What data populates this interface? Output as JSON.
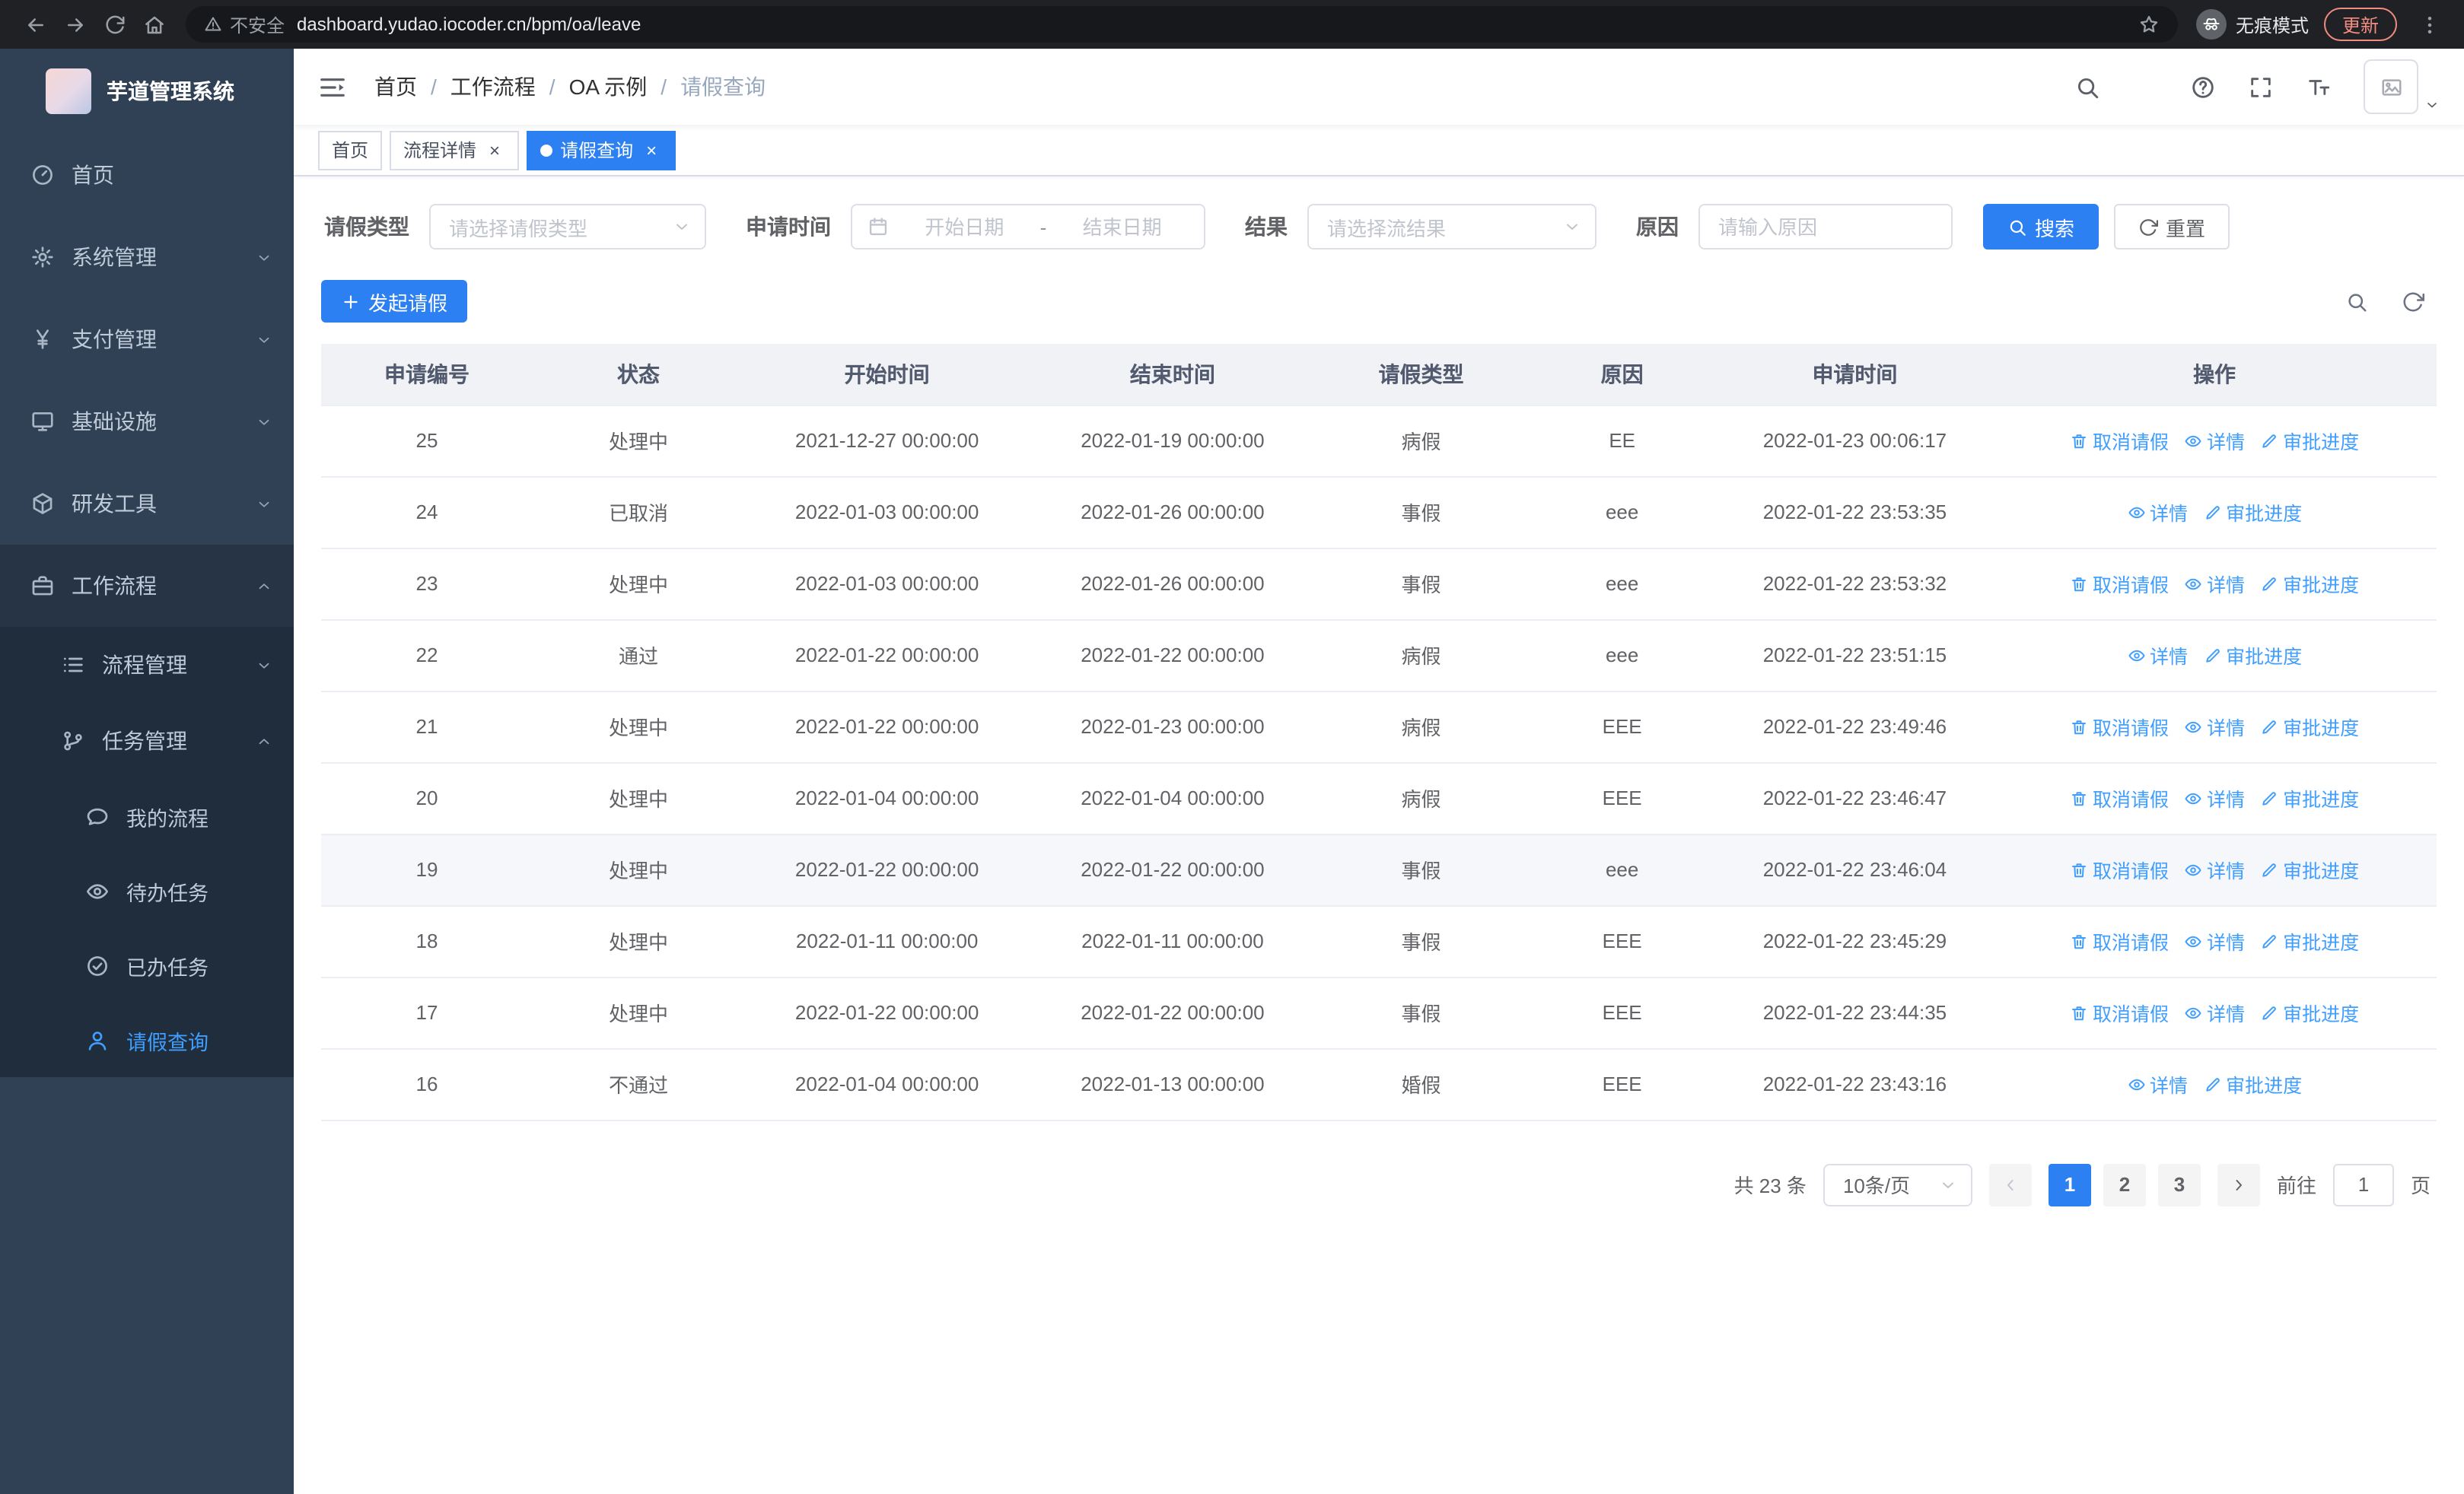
{
  "theme": {
    "primary": "#2d80f2",
    "link": "#409eff",
    "sidebar-bg": "#304156",
    "submenu-bg": "#1f2d3d",
    "sidebar-open-bg": "#263445"
  },
  "browser": {
    "security_label": "不安全",
    "url": "dashboard.yudao.iocoder.cn/bpm/oa/leave",
    "incognito_label": "无痕模式",
    "update_label": "更新"
  },
  "sidebar": {
    "title": "芋道管理系统",
    "items": [
      {
        "label": "首页",
        "icon": "dashboard-icon"
      },
      {
        "label": "系统管理",
        "icon": "gear-icon",
        "group": true
      },
      {
        "label": "支付管理",
        "icon": "yen-icon",
        "group": true
      },
      {
        "label": "基础设施",
        "icon": "monitor-icon",
        "group": true
      },
      {
        "label": "研发工具",
        "icon": "box-icon",
        "group": true
      },
      {
        "label": "工作流程",
        "icon": "briefcase-icon",
        "group": true,
        "expanded": true,
        "children": [
          {
            "label": "流程管理",
            "icon": "list-icon",
            "group": true
          },
          {
            "label": "任务管理",
            "icon": "tasks-icon",
            "group": true,
            "expanded": true,
            "children": [
              {
                "label": "我的流程",
                "icon": "chat-icon"
              },
              {
                "label": "待办任务",
                "icon": "eye-icon"
              },
              {
                "label": "已办任务",
                "icon": "check-icon"
              },
              {
                "label": "请假查询",
                "icon": "user-icon",
                "active": true
              }
            ]
          }
        ]
      }
    ]
  },
  "navbar": {
    "breadcrumb": [
      "首页",
      "工作流程",
      "OA 示例",
      "请假查询"
    ]
  },
  "tags": [
    {
      "label": "首页",
      "closable": false,
      "active": false
    },
    {
      "label": "流程详情",
      "closable": true,
      "active": false
    },
    {
      "label": "请假查询",
      "closable": true,
      "active": true
    }
  ],
  "filters": {
    "type_label": "请假类型",
    "type_placeholder": "请选择请假类型",
    "time_label": "申请时间",
    "start_placeholder": "开始日期",
    "separator": "-",
    "end_placeholder": "结束日期",
    "result_label": "结果",
    "result_placeholder": "请选择流结果",
    "reason_label": "原因",
    "reason_placeholder": "请输入原因",
    "search_label": "搜索",
    "reset_label": "重置"
  },
  "toolbar": {
    "create_label": "发起请假"
  },
  "table": {
    "columns": [
      "申请编号",
      "状态",
      "开始时间",
      "结束时间",
      "请假类型",
      "原因",
      "申请时间",
      "操作"
    ],
    "actions": {
      "cancel": "取消请假",
      "detail": "详情",
      "progress": "审批进度"
    },
    "rows": [
      {
        "id": "25",
        "status": "处理中",
        "start": "2021-12-27 00:00:00",
        "end": "2022-01-19 00:00:00",
        "type": "病假",
        "reason": "EE",
        "applied": "2022-01-23 00:06:17",
        "cancellable": true,
        "highlighted": false
      },
      {
        "id": "24",
        "status": "已取消",
        "start": "2022-01-03 00:00:00",
        "end": "2022-01-26 00:00:00",
        "type": "事假",
        "reason": "eee",
        "applied": "2022-01-22 23:53:35",
        "cancellable": false,
        "highlighted": false
      },
      {
        "id": "23",
        "status": "处理中",
        "start": "2022-01-03 00:00:00",
        "end": "2022-01-26 00:00:00",
        "type": "事假",
        "reason": "eee",
        "applied": "2022-01-22 23:53:32",
        "cancellable": true,
        "highlighted": false
      },
      {
        "id": "22",
        "status": "通过",
        "start": "2022-01-22 00:00:00",
        "end": "2022-01-22 00:00:00",
        "type": "病假",
        "reason": "eee",
        "applied": "2022-01-22 23:51:15",
        "cancellable": false,
        "highlighted": false
      },
      {
        "id": "21",
        "status": "处理中",
        "start": "2022-01-22 00:00:00",
        "end": "2022-01-23 00:00:00",
        "type": "病假",
        "reason": "EEE",
        "applied": "2022-01-22 23:49:46",
        "cancellable": true,
        "highlighted": false
      },
      {
        "id": "20",
        "status": "处理中",
        "start": "2022-01-04 00:00:00",
        "end": "2022-01-04 00:00:00",
        "type": "病假",
        "reason": "EEE",
        "applied": "2022-01-22 23:46:47",
        "cancellable": true,
        "highlighted": false
      },
      {
        "id": "19",
        "status": "处理中",
        "start": "2022-01-22 00:00:00",
        "end": "2022-01-22 00:00:00",
        "type": "事假",
        "reason": "eee",
        "applied": "2022-01-22 23:46:04",
        "cancellable": true,
        "highlighted": true
      },
      {
        "id": "18",
        "status": "处理中",
        "start": "2022-01-11 00:00:00",
        "end": "2022-01-11 00:00:00",
        "type": "事假",
        "reason": "EEE",
        "applied": "2022-01-22 23:45:29",
        "cancellable": true,
        "highlighted": false
      },
      {
        "id": "17",
        "status": "处理中",
        "start": "2022-01-22 00:00:00",
        "end": "2022-01-22 00:00:00",
        "type": "事假",
        "reason": "EEE",
        "applied": "2022-01-22 23:44:35",
        "cancellable": true,
        "highlighted": false
      },
      {
        "id": "16",
        "status": "不通过",
        "start": "2022-01-04 00:00:00",
        "end": "2022-01-13 00:00:00",
        "type": "婚假",
        "reason": "EEE",
        "applied": "2022-01-22 23:43:16",
        "cancellable": false,
        "highlighted": false
      }
    ]
  },
  "pagination": {
    "total": "共 23 条",
    "page_size": "10条/页",
    "pages": [
      "1",
      "2",
      "3"
    ],
    "active": "1",
    "goto_label": "前往",
    "goto_value": "1",
    "page_suffix": "页"
  }
}
